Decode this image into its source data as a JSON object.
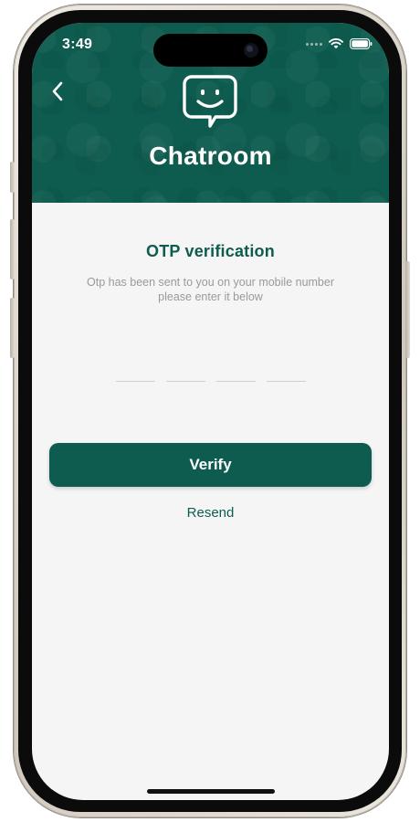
{
  "status_bar": {
    "time": "3:49",
    "icons": [
      "signal-dots-icon",
      "wifi-icon",
      "battery-icon"
    ]
  },
  "header": {
    "back_icon": "chevron-left-icon",
    "logo_icon": "chat-bubble-smiley-icon",
    "app_title": "Chatroom"
  },
  "otp": {
    "title": "OTP verification",
    "subtitle_line1": "Otp has been sent to you on your mobile number",
    "subtitle_line2": "please enter it below",
    "digits": [
      "",
      "",
      "",
      ""
    ]
  },
  "actions": {
    "verify_label": "Verify",
    "resend_label": "Resend"
  },
  "colors": {
    "brand": "#0d5c4f",
    "background": "#f5f5f5",
    "subtitle": "#9a9a9a"
  }
}
